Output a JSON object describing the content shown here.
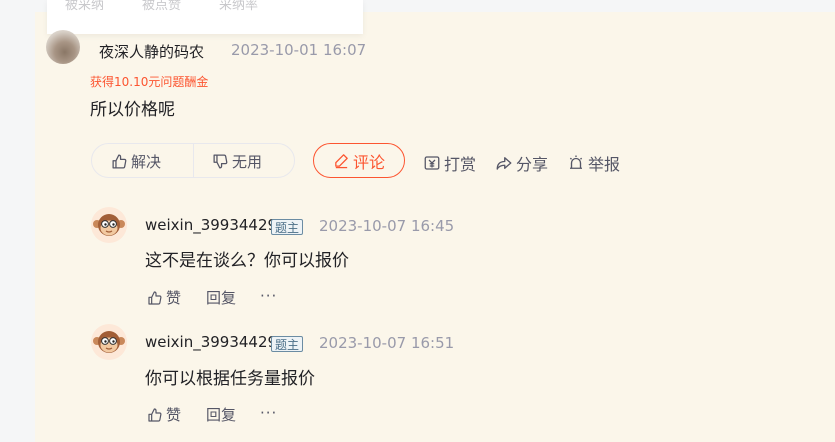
{
  "stats": {
    "labels": [
      "被采纳",
      "被点赞",
      "采纳率"
    ]
  },
  "answer": {
    "username": "夜深人静的码农",
    "time": "2023-10-01 16:07",
    "reward": "获得10.10元问题酬金",
    "content": "所以价格呢",
    "actions": {
      "solve": "解决",
      "useless": "无用",
      "comment": "评论",
      "tip": "打赏",
      "share": "分享",
      "report": "举报"
    }
  },
  "replies": [
    {
      "username": "weixin_39934429",
      "badge": "题主",
      "time": "2023-10-07 16:45",
      "content": "这不是在谈么？你可以报价",
      "like": "赞",
      "reply": "回复",
      "more": "···"
    },
    {
      "username": "weixin_39934429",
      "badge": "题主",
      "time": "2023-10-07 16:51",
      "content": "你可以根据任务量报价",
      "like": "赞",
      "reply": "回复",
      "more": "···"
    }
  ],
  "colors": {
    "accent": "#fc5531",
    "panel": "#fbf6ea",
    "muted": "#999aaa",
    "badge": "#6b8ca3"
  }
}
